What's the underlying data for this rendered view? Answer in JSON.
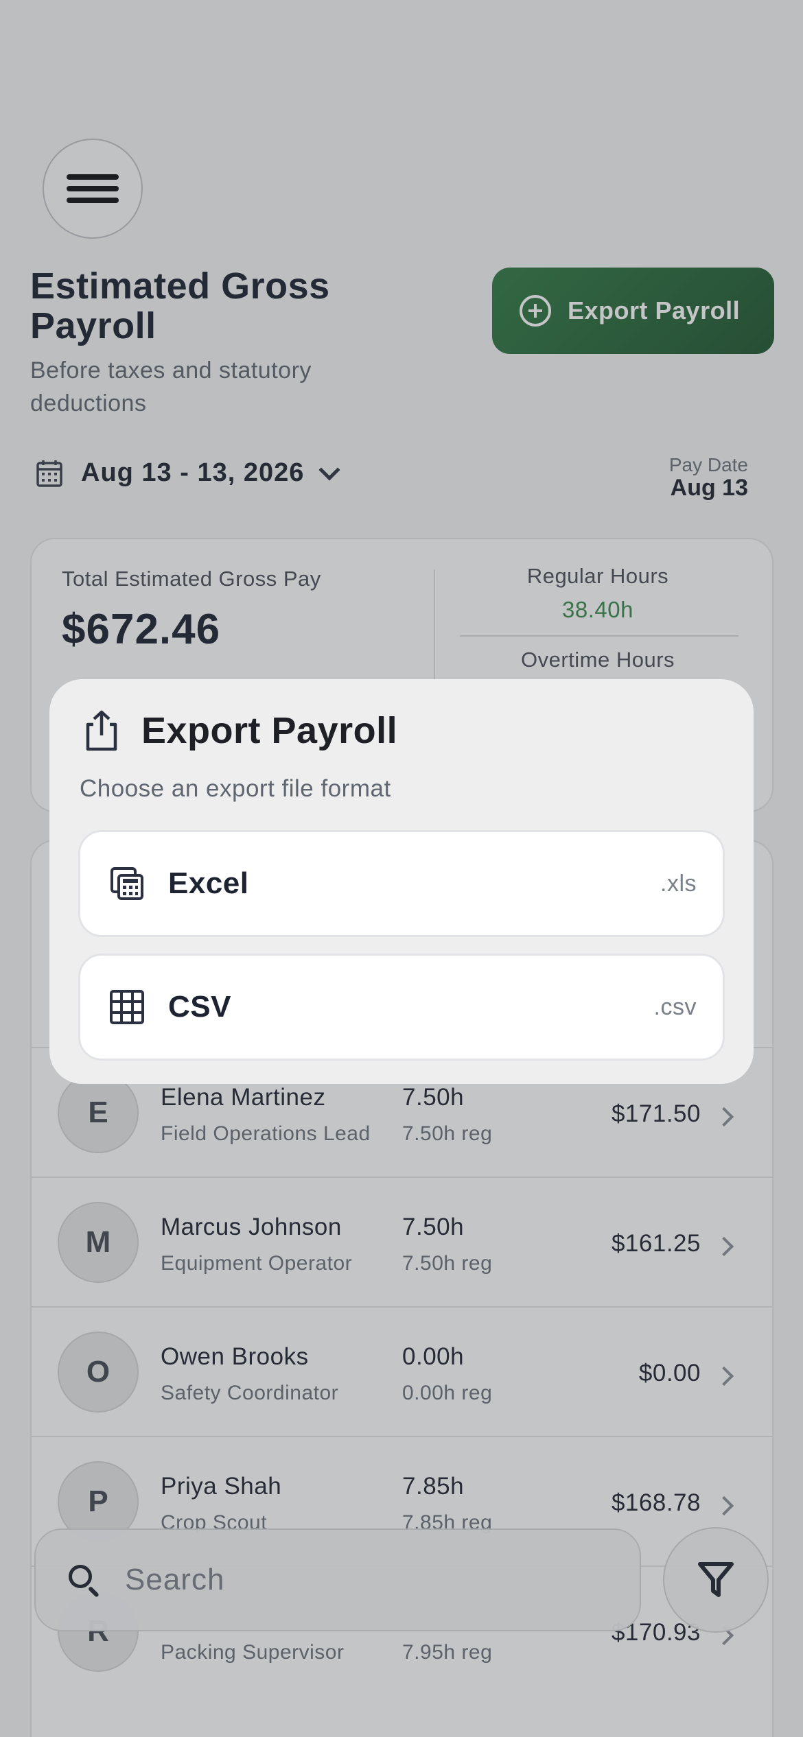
{
  "header": {
    "title": "Estimated Gross Payroll",
    "subtitle": "Before taxes and statutory deductions",
    "export_button_label": "Export Payroll"
  },
  "period": {
    "date_range": "Aug 13 - 13, 2026",
    "pay_date_label": "Pay Date",
    "pay_date_value": "Aug 13"
  },
  "summary": {
    "total_label": "Total Estimated Gross Pay",
    "total_value": "$672.46",
    "regular_hours_label": "Regular Hours",
    "regular_hours_value": "38.40h",
    "overtime_hours_label": "Overtime Hours"
  },
  "employees": [
    {
      "initial": "E",
      "name": "Elena Martinez",
      "role": "Field Operations Lead",
      "hours": "7.50h",
      "reg": "7.50h reg",
      "pay": "$171.50"
    },
    {
      "initial": "M",
      "name": "Marcus Johnson",
      "role": "Equipment Operator",
      "hours": "7.50h",
      "reg": "7.50h reg",
      "pay": "$161.25"
    },
    {
      "initial": "O",
      "name": "Owen Brooks",
      "role": "Safety Coordinator",
      "hours": "0.00h",
      "reg": "0.00h reg",
      "pay": "$0.00"
    },
    {
      "initial": "P",
      "name": "Priya Shah",
      "role": "Crop Scout",
      "hours": "7.85h",
      "reg": "7.85h reg",
      "pay": "$168.78"
    },
    {
      "initial": "R",
      "name": "",
      "role": "Packing Supervisor",
      "hours": "",
      "reg": "7.95h reg",
      "pay": "$170.93"
    }
  ],
  "search": {
    "placeholder": "Search"
  },
  "modal": {
    "title": "Export Payroll",
    "subtitle": "Choose an export file format",
    "options": [
      {
        "label": "Excel",
        "ext": ".xls",
        "icon": "spreadsheet-icon"
      },
      {
        "label": "CSV",
        "ext": ".csv",
        "icon": "grid-icon"
      }
    ]
  },
  "colors": {
    "accent": "#2a6b3c",
    "regular_hours": "#3a8a4c"
  }
}
